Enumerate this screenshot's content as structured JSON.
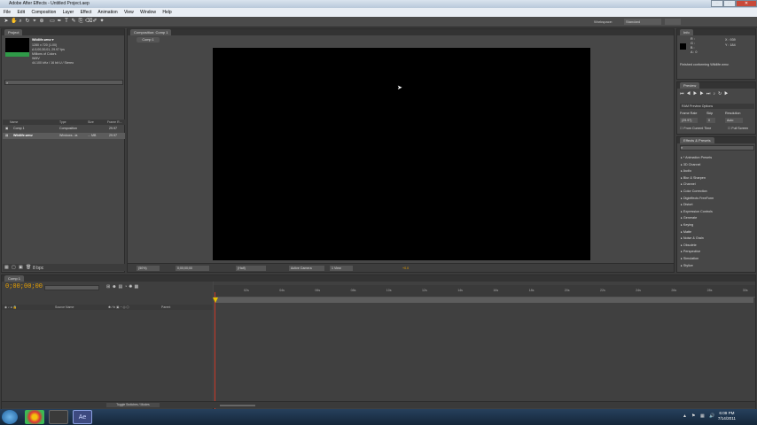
{
  "window": {
    "title": "Adobe After Effects - Untitled Project.aep"
  },
  "menu": [
    "File",
    "Edit",
    "Composition",
    "Layer",
    "Effect",
    "Animation",
    "View",
    "Window",
    "Help"
  ],
  "toolbar": {
    "workspace_label": "Workspace:",
    "workspace_value": "Standard"
  },
  "project": {
    "tab": "Project",
    "selected_name": "Wildlife.wmv ▾",
    "info_lines": [
      "1280 x 720 (1.00)",
      "Δ 0;00;30;01, 29.97 fps",
      "Millions of Colors",
      "WMV",
      "44.100 kHz / 16 bit U / Stereo"
    ],
    "columns": {
      "name": "Name",
      "type": "Type",
      "size": "Size",
      "frame_rate": "Frame R..."
    },
    "rows": [
      {
        "name": "Comp 1",
        "type": "Composition",
        "size": "",
        "fps": "29.97"
      },
      {
        "name": "Wildlife.wmv",
        "type": "Windows...ia",
        "size": "... MB",
        "fps": "29.97"
      }
    ],
    "bpc": "8 bpc"
  },
  "composition": {
    "tab": "Composition: Comp 1",
    "subtab": "Comp 1",
    "footer": {
      "zoom": "(50%)",
      "timecode": "0;00;00;00",
      "resolution": "(Half)",
      "camera": "Active Camera",
      "views": "1 View",
      "exposure": "+0.0"
    }
  },
  "info": {
    "tab": "Info",
    "r": "R :",
    "g": "G :",
    "b": "B :",
    "a": "A : 0",
    "x": "X : 939",
    "y": "Y : 184",
    "status": "Finished conforming Wildlife.wmv."
  },
  "preview": {
    "tab": "Preview",
    "ram_options": "RAM Preview Options",
    "frame_rate_label": "Frame Rate",
    "skip_label": "Skip",
    "resolution_label": "Resolution",
    "frame_rate_value": "(29.97)",
    "skip_value": "0",
    "resolution_value": "Auto",
    "from_current": "From Current Time",
    "full_screen": "Full Screen"
  },
  "effects": {
    "tab": "Effects & Presets",
    "items": [
      "* Animation Presets",
      "3D Channel",
      "Audio",
      "Blur & Sharpen",
      "Channel",
      "Color Correction",
      "Digieffects FreeForm",
      "Distort",
      "Expression Controls",
      "Generate",
      "Keying",
      "Matte",
      "Noise & Grain",
      "Obsolete",
      "Perspective",
      "Simulation",
      "Stylize"
    ]
  },
  "timeline": {
    "tab": "Comp 1",
    "timecode": "0;00;00;00",
    "col_source": "Source Name",
    "col_parent": "Parent",
    "ticks": [
      "02s",
      "04s",
      "06s",
      "08s",
      "10s",
      "12s",
      "14s",
      "16s",
      "18s",
      "20s",
      "22s",
      "24s",
      "26s",
      "28s",
      "30s"
    ],
    "toggle": "Toggle Switches / Modes"
  },
  "taskbar": {
    "time": "6:09 PM",
    "date": "7/14/2011"
  },
  "colors": {
    "accent": "#e7a000",
    "playhead": "#c83a2a",
    "panel": "#474747"
  }
}
